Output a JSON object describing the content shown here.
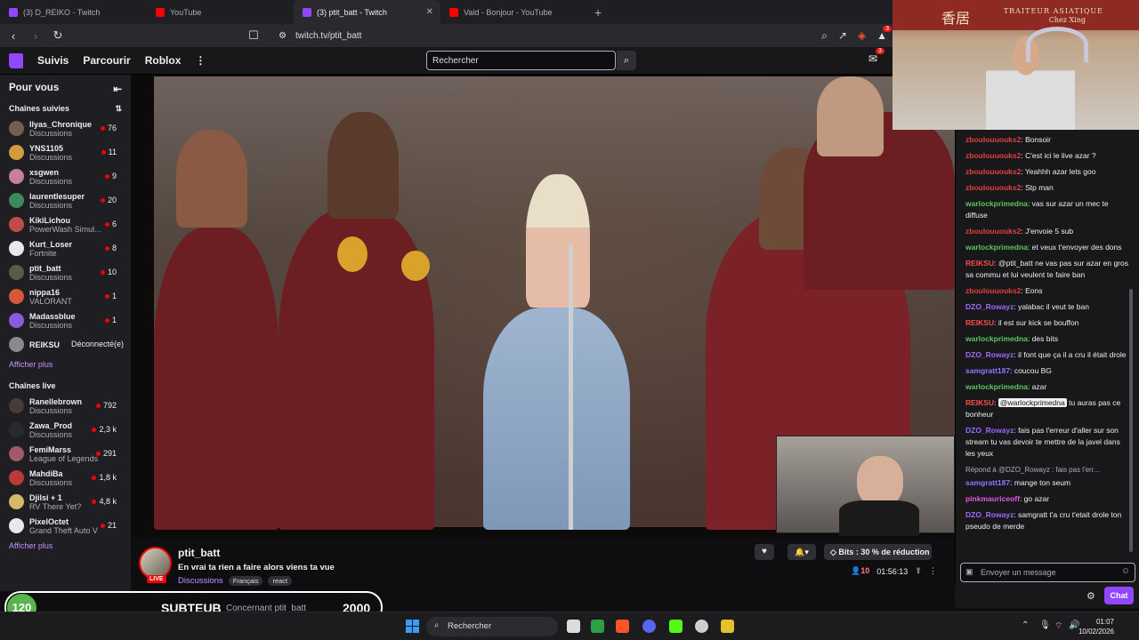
{
  "browser": {
    "tabs": [
      {
        "title": "(3) D_REIKO - Twitch",
        "icon": "twitch-tab-icon",
        "active": false
      },
      {
        "title": "YouTube",
        "icon": "youtube-tab-icon",
        "active": false
      },
      {
        "title": "(3) ptit_batt - Twitch",
        "icon": "twitch-tab-icon",
        "active": true
      },
      {
        "title": "Vald - Bonjour - YouTube",
        "icon": "youtube-tab-icon",
        "active": false
      }
    ],
    "close_glyph": "✕",
    "new_tab_glyph": "+",
    "url": "twitch.tv/ptit_batt",
    "ext_badge": "3"
  },
  "twitch_nav": {
    "follow": "Suivis",
    "browse": "Parcourir",
    "roblox": "Roblox",
    "more": "⋮",
    "search_placeholder": "Rechercher",
    "inbox_badge": "3"
  },
  "sidebar": {
    "title": "Pour vous",
    "followed_title": "Chaînes suivies",
    "followed": [
      {
        "name": "Ilyas_Chronique",
        "category": "Discussions",
        "viewers": "76",
        "color": "#7a5c4a"
      },
      {
        "name": "YNS1105",
        "category": "Discussions",
        "viewers": "11",
        "color": "#d49b3c"
      },
      {
        "name": "xsgwen",
        "category": "Discussions",
        "viewers": "9",
        "color": "#c87f9e"
      },
      {
        "name": "laurentlesuper",
        "category": "Discussions",
        "viewers": "20",
        "color": "#3a8a5a"
      },
      {
        "name": "KikiLichou",
        "category": "PowerWash Simul...",
        "viewers": "6",
        "color": "#c24a4a"
      },
      {
        "name": "Kurt_Loser",
        "category": "Fortnite",
        "viewers": "8",
        "color": "#e8e8e8"
      },
      {
        "name": "ptit_batt",
        "category": "Discussions",
        "viewers": "10",
        "color": "#5a5a4a"
      },
      {
        "name": "nippa16",
        "category": "VALORANT",
        "viewers": "1",
        "color": "#d6583a"
      },
      {
        "name": "Madassblue",
        "category": "Discussions",
        "viewers": "1",
        "color": "#8a5adf"
      }
    ],
    "offline": {
      "name": "REIKSU",
      "status": "Déconnecté(e)",
      "color": "#8a8a8a"
    },
    "show_more": "Afficher plus",
    "live_title": "Chaînes live",
    "live": [
      {
        "name": "Ranellebrown",
        "category": "Discussions",
        "viewers": "792",
        "color": "#4a3a3a"
      },
      {
        "name": "Zawa_Prod",
        "category": "Discussions",
        "viewers": "2,3 k",
        "color": "#2a2a2a"
      },
      {
        "name": "FemiMarss",
        "category": "League of Legends",
        "viewers": "291",
        "color": "#a05a6a"
      },
      {
        "name": "MahdiBa",
        "category": "Discussions",
        "viewers": "1,8 k",
        "color": "#b83a3a"
      },
      {
        "name": "Djilsi + 1",
        "category": "RV There Yet?",
        "viewers": "4,8 k",
        "color": "#d6b86a"
      },
      {
        "name": "PixelOctet",
        "category": "Grand Theft Auto V",
        "viewers": "21",
        "color": "#e8e8e8"
      }
    ],
    "show_more_live": "Afficher plus"
  },
  "stream": {
    "name": "ptit_batt",
    "title": "En vrai ta rien a faire alors viens ta vue",
    "category": "Discussions",
    "tags": [
      "Français",
      "react"
    ],
    "live_label": "LIVE",
    "bits_label": "Bits : 30 % de réduction",
    "viewers": "10",
    "uptime": "01:56:13"
  },
  "chat": {
    "messages": [
      {
        "user": "zboulouuouks2",
        "color": "#e0403a",
        "text": "Bonsoir"
      },
      {
        "user": "zboulouuouks2",
        "color": "#e0403a",
        "text": "C'est ici le live azar ?"
      },
      {
        "user": "zboulouuouks2",
        "color": "#e0403a",
        "text": "Yeahhh azar lets goo"
      },
      {
        "user": "zboulouuouks2",
        "color": "#e0403a",
        "text": "Stp man"
      },
      {
        "user": "warlockprimedna",
        "color": "#5ec45e",
        "text": "vas sur azar un mec te diffuse"
      },
      {
        "user": "zboulouuouks2",
        "color": "#e0403a",
        "text": "J'envoie 5 sub"
      },
      {
        "user": "warlockprimedna",
        "color": "#5ec45e",
        "text": "et veux t'envoyer des dons"
      },
      {
        "user": "REIKSU",
        "color": "#ff4a4a",
        "text": "@ptit_batt ne vas pas sur azar en gros sa commu et lui veulent te faire ban"
      },
      {
        "user": "zboulouuouks2",
        "color": "#e0403a",
        "text": "Eons"
      },
      {
        "user": "DZO_Rowayz",
        "color": "#9a6aff",
        "text": "yalabac il veut te ban"
      },
      {
        "user": "REIKSU",
        "color": "#ff4a4a",
        "text": "il est sur kick se bouffon"
      },
      {
        "user": "warlockprimedna",
        "color": "#5ec45e",
        "text": "des bits"
      },
      {
        "user": "DZO_Rowayz",
        "color": "#9a6aff",
        "text": "il font que ça il a cru il était drole"
      },
      {
        "user": "samgratt187",
        "color": "#8a7aff",
        "text": "coucou BG"
      },
      {
        "user": "warlockprimedna",
        "color": "#5ec45e",
        "text": "azar"
      },
      {
        "user": "REIKSU",
        "color": "#ff4a4a",
        "mention": "@warlockprimedna",
        "text": "tu auras pas ce bonheur"
      },
      {
        "user": "DZO_Rowayz",
        "color": "#9a6aff",
        "text": "fais pas l'erreur d'aller sur son stream tu vas devoir te mettre de la javel dans les yeux"
      },
      {
        "reply": "Répond à @DZO_Rowayz : fais pas l'err...",
        "user": "samgratt187",
        "color": "#8a7aff",
        "text": "mange ton seum"
      },
      {
        "user": "pinkmauriceoff",
        "color": "#e05ae0",
        "text": "go azar"
      },
      {
        "user": "DZO_Rowayz",
        "color": "#9a6aff",
        "text": "samgratt t'a cru t'etait drole ton pseudo de merde"
      }
    ],
    "input_placeholder": "Envoyer un message",
    "send_label": "Chat"
  },
  "webcam": {
    "sign_cn": "香居",
    "sign_line1": "TRAITEUR ASIATIQUE",
    "sign_line2": "Chez Xing"
  },
  "subgoal": {
    "current": "120",
    "label": "SUBTEUB",
    "ghost_text": "Concernant ptit_batt",
    "target": "2000"
  },
  "taskbar": {
    "search": "Rechercher",
    "time": "01:07",
    "date": "10/02/2026"
  }
}
